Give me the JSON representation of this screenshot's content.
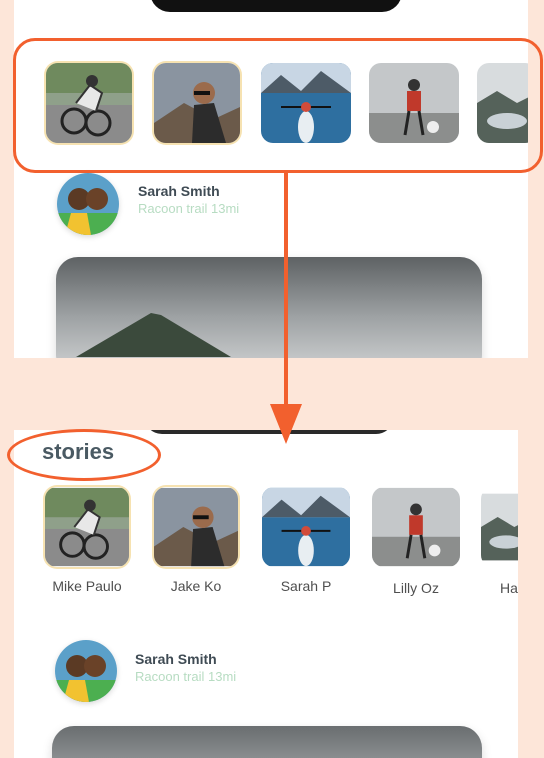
{
  "colors": {
    "background": "#fde6d9",
    "annotation": "#f2602e",
    "heading": "#4a5a63",
    "subtitle": "#b7dcc2"
  },
  "stories_section": {
    "heading": "stories",
    "stories": [
      {
        "name": "Mike Paulo",
        "icon": "cyclist-photo"
      },
      {
        "name": "Jake Ko",
        "icon": "man-drinking-photo"
      },
      {
        "name": "Sarah P",
        "icon": "kayak-photo"
      },
      {
        "name": "Lilly Oz",
        "icon": "hiker-photo"
      },
      {
        "name": "Ha",
        "icon": "lake-photo"
      }
    ]
  },
  "post": {
    "author": "Sarah Smith",
    "subtitle": "Racoon trail 13mi",
    "avatar_icon": "two-friends-photo",
    "photo_icon": "mountain-photo"
  }
}
